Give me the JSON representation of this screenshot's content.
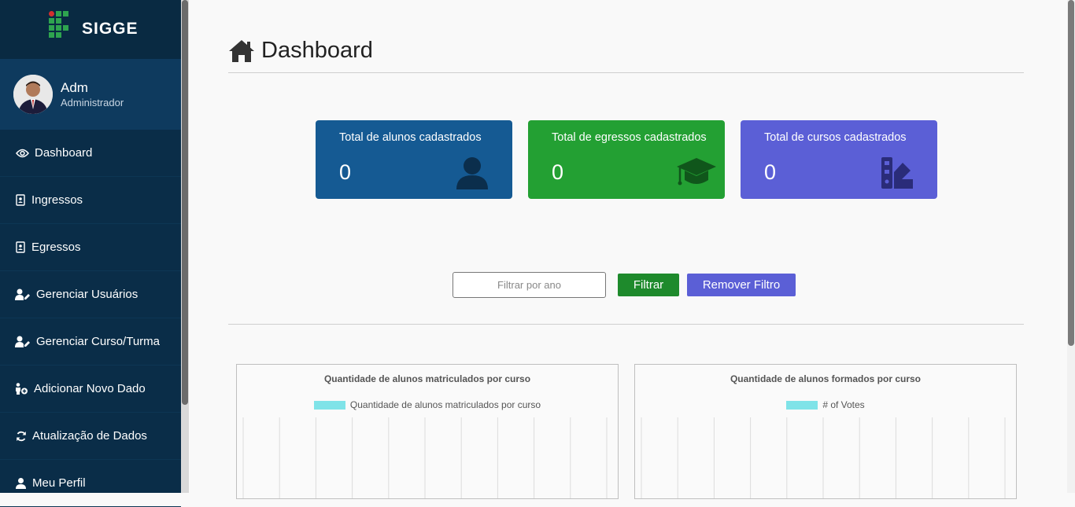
{
  "app": {
    "name": "SIGGE"
  },
  "user": {
    "name": "Adm",
    "role": "Administrador"
  },
  "sidebar": {
    "items": [
      {
        "label": "Dashboard",
        "icon": "eye-icon"
      },
      {
        "label": "Ingressos",
        "icon": "contact-book-icon"
      },
      {
        "label": "Egressos",
        "icon": "contact-book-icon"
      },
      {
        "label": "Gerenciar Usuários",
        "icon": "user-edit-icon"
      },
      {
        "label": "Gerenciar Curso/Turma",
        "icon": "user-edit-icon"
      },
      {
        "label": "Adicionar Novo Dado",
        "icon": "user-plus-icon"
      },
      {
        "label": "Atualização de Dados",
        "icon": "sync-icon"
      },
      {
        "label": "Meu Perfil",
        "icon": "user-icon"
      }
    ]
  },
  "page": {
    "title": "Dashboard"
  },
  "cards": [
    {
      "label": "Total de alunos cadastrados",
      "value": "0",
      "color": "#155a93",
      "icon": "user-icon"
    },
    {
      "label": "Total de egressos cadastrados",
      "value": "0",
      "color": "#23a033",
      "icon": "graduation-cap-icon"
    },
    {
      "label": "Total de cursos cadastrados",
      "value": "0",
      "color": "#5b5fd6",
      "icon": "swatchbook-icon"
    }
  ],
  "filter": {
    "placeholder": "Filtrar por ano",
    "value": "",
    "filter_label": "Filtrar",
    "remove_label": "Remover Filtro",
    "filter_color": "#1e8a2c",
    "remove_color": "#5b5fd6"
  },
  "chart_data": [
    {
      "type": "bar",
      "title": "Quantidade de alunos matriculados por curso",
      "series": [
        {
          "name": "Quantidade de alunos matriculados por curso",
          "values": []
        }
      ],
      "categories": [],
      "color": "#7fe3e8",
      "grid": true,
      "legend": "top"
    },
    {
      "type": "bar",
      "title": "Quantidade de alunos formados por curso",
      "series": [
        {
          "name": "# of Votes",
          "values": []
        }
      ],
      "categories": [],
      "color": "#7fe3e8",
      "grid": true,
      "legend": "top"
    }
  ]
}
